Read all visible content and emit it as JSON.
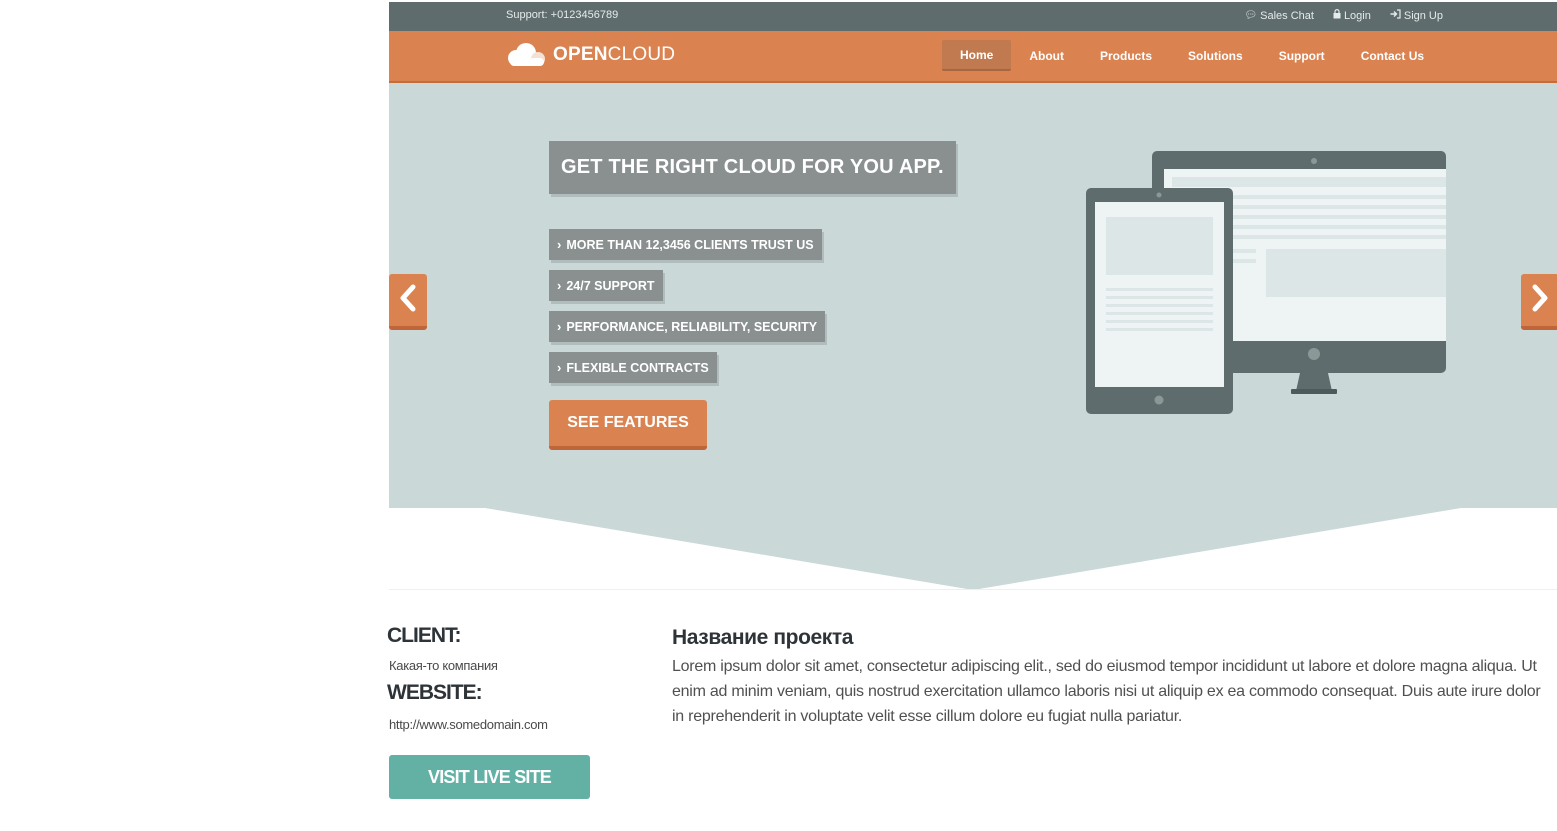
{
  "topbar": {
    "support": "Support: +0123456789",
    "links": [
      {
        "icon": "chat-icon",
        "label": "Sales Chat"
      },
      {
        "icon": "lock-icon",
        "label": "Login"
      },
      {
        "icon": "sign-in-icon",
        "label": "Sign Up"
      }
    ]
  },
  "navbar": {
    "logo": {
      "icon": "cloud-icon",
      "brand_bold": "OPEN",
      "brand_light": "CLOUD"
    },
    "menu": [
      {
        "label": "Home",
        "active": true
      },
      {
        "label": "About"
      },
      {
        "label": "Products"
      },
      {
        "label": "Solutions"
      },
      {
        "label": "Support"
      },
      {
        "label": "Contact Us"
      }
    ]
  },
  "hero": {
    "headline": "GET THE RIGHT CLOUD FOR YOU APP.",
    "features": [
      "MORE THAN 12,3456 CLIENTS TRUST US",
      "24/7 SUPPORT",
      "PERFORMANCE, RELIABILITY, SECURITY",
      "FLEXIBLE CONTRACTS"
    ],
    "cta": "SEE FEATURES",
    "prev_icon": "chevron-left-icon",
    "next_icon": "chevron-right-icon",
    "illustration": "devices-icon"
  },
  "project": {
    "client_label": "CLIENT:",
    "client_value": "Какая-то компания",
    "website_label": "WEBSITE:",
    "website_value": "http://www.somedomain.com",
    "visit_button": "VISIT LIVE SITE",
    "title": "Название проекта",
    "description": "Lorem ipsum dolor sit amet, consectetur adipiscing elit., sed do eiusmod tempor incididunt ut labore et dolore magna aliqua. Ut enim ad minim veniam, quis nostrud exercitation ullamco laboris nisi ut aliquip ex ea commodo consequat. Duis aute irure dolor in reprehenderit in voluptate velit esse cillum dolore eu fugiat nulla pariatur."
  },
  "colors": {
    "topbar": "#5e6c6d",
    "navbar": "#da8351",
    "hero_bg": "#cad8d8",
    "tag_bg": "#8a9090",
    "visit_button": "#63b1a5",
    "heading_text": "#2e3338"
  }
}
